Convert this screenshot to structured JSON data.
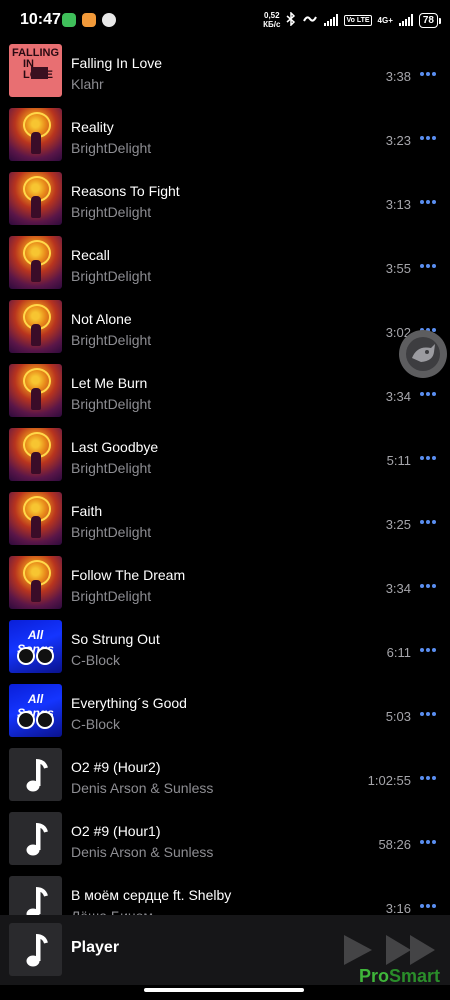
{
  "status_bar": {
    "time": "10:47",
    "speed_value": "0,52",
    "speed_unit": "КБ/с",
    "volte_label": "Vo LTE",
    "network_label": "4G+",
    "battery": "78"
  },
  "tracks": [
    {
      "title": "Falling In Love",
      "artist": "Klahr",
      "duration": "3:38",
      "cover": "falling-in-love-art",
      "cover_text": "FALLING IN LOVE"
    },
    {
      "title": "Reality",
      "artist": "BrightDelight",
      "duration": "3:23",
      "cover": "brightdelight-art"
    },
    {
      "title": "Reasons To Fight",
      "artist": "BrightDelight",
      "duration": "3:13",
      "cover": "brightdelight-art"
    },
    {
      "title": "Recall",
      "artist": "BrightDelight",
      "duration": "3:55",
      "cover": "brightdelight-art"
    },
    {
      "title": "Not Alone",
      "artist": "BrightDelight",
      "duration": "3:02",
      "cover": "brightdelight-art"
    },
    {
      "title": "Let Me Burn",
      "artist": "BrightDelight",
      "duration": "3:34",
      "cover": "brightdelight-art"
    },
    {
      "title": "Last Goodbye",
      "artist": "BrightDelight",
      "duration": "5:11",
      "cover": "brightdelight-art"
    },
    {
      "title": "Faith",
      "artist": "BrightDelight",
      "duration": "3:25",
      "cover": "brightdelight-art"
    },
    {
      "title": "Follow The Dream",
      "artist": "BrightDelight",
      "duration": "3:34",
      "cover": "brightdelight-art"
    },
    {
      "title": "So Strung Out",
      "artist": "C-Block",
      "duration": "6:11",
      "cover": "all-songs-art",
      "cover_text": "All Songs"
    },
    {
      "title": "Everything´s Good",
      "artist": "C-Block",
      "duration": "5:03",
      "cover": "all-songs-art",
      "cover_text": "All Songs"
    },
    {
      "title": "O2 #9 (Hour2)",
      "artist": "Denis Arson & Sunless",
      "duration": "1:02:55",
      "cover": "music-note-icon"
    },
    {
      "title": "O2 #9 (Hour1)",
      "artist": "Denis Arson & Sunless",
      "duration": "58:26",
      "cover": "music-note-icon"
    },
    {
      "title": "В моём сердце ft. Shelby",
      "artist": "Лёша Бином",
      "duration": "3:16",
      "cover": "music-note-icon"
    }
  ],
  "player": {
    "label": "Player",
    "cover": "music-note-icon",
    "play_icon": "play-icon",
    "next_icon": "skip-next-icon"
  },
  "overlay": {
    "bubble_icon": "assistant-bubble-icon"
  },
  "watermark": {
    "part_a": "Pro",
    "part_b": "Smart"
  },
  "colors": {
    "background": "#000000",
    "accent": "#5a8ef0",
    "secondary_text": "#8d8d92",
    "player_bar": "#161618"
  }
}
